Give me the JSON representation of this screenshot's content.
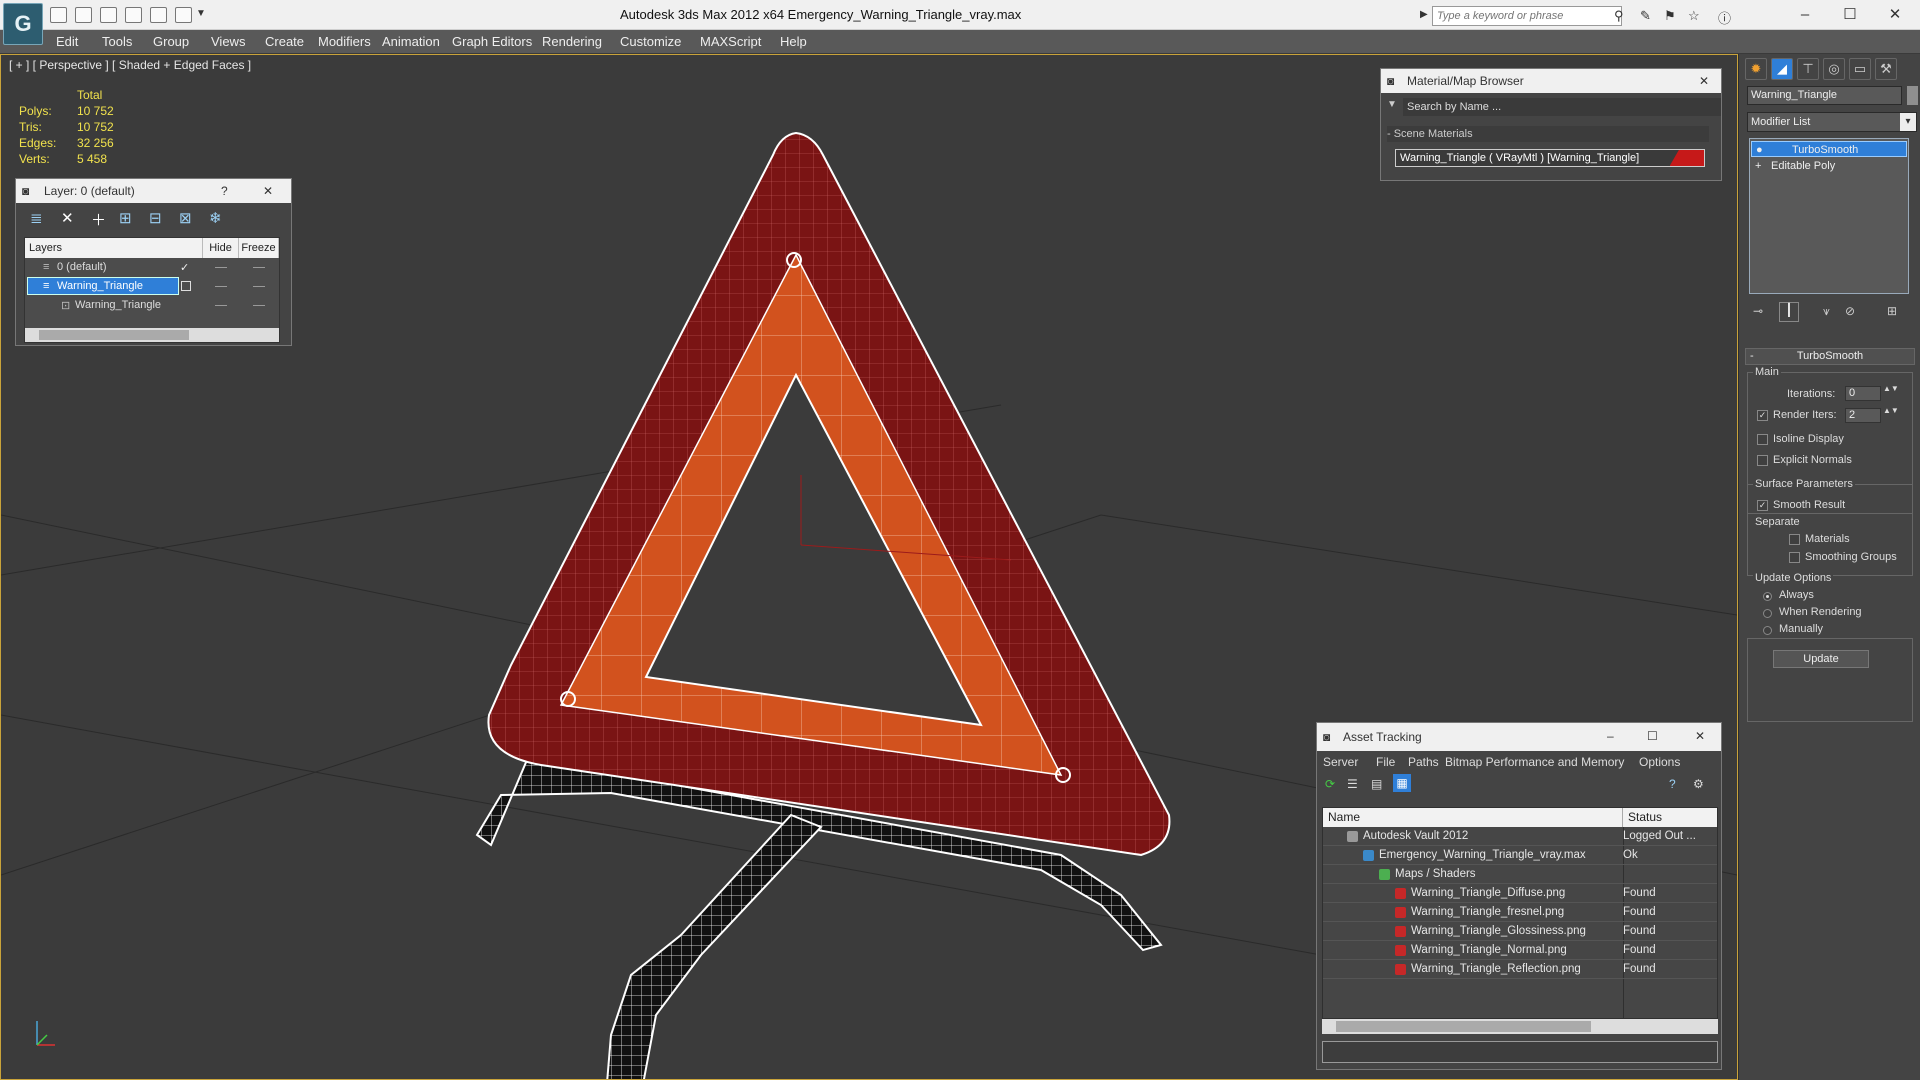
{
  "window": {
    "title": "Autodesk 3ds Max  2012 x64      Emergency_Warning_Triangle_vray.max",
    "search_placeholder": "Type a keyword or phrase",
    "logo": "G"
  },
  "menu": [
    "Edit",
    "Tools",
    "Group",
    "Views",
    "Create",
    "Modifiers",
    "Animation",
    "Graph Editors",
    "Rendering",
    "Customize",
    "MAXScript",
    "Help"
  ],
  "viewport": {
    "label": "[ + ] [ Perspective ] [ Shaded + Edged Faces ]",
    "stats": {
      "header": "Total",
      "polys_label": "Polys:",
      "polys": "10 752",
      "tris_label": "Tris:",
      "tris": "10 752",
      "edges_label": "Edges:",
      "edges": "32 256",
      "verts_label": "Verts:",
      "verts": "5 458"
    }
  },
  "layer_dialog": {
    "title": "Layer: 0 (default)",
    "help": "?",
    "columns": {
      "layers": "Layers",
      "hide": "Hide",
      "freeze": "Freeze"
    },
    "rows": [
      "0 (default)",
      "Warning_Triangle",
      "Warning_Triangle"
    ]
  },
  "material_browser": {
    "title": "Material/Map Browser",
    "search_placeholder": "Search by Name ...",
    "group": "- Scene Materials",
    "entry": "Warning_Triangle  ( VRayMtl )  [Warning_Triangle]"
  },
  "asset_tracking": {
    "title": "Asset Tracking",
    "menu": [
      "Server",
      "File",
      "Paths",
      "Bitmap Performance and Memory",
      "Options"
    ],
    "columns": {
      "name": "Name",
      "status": "Status"
    },
    "rows": [
      {
        "name": "Autodesk Vault 2012",
        "status": "Logged Out ..."
      },
      {
        "name": "Emergency_Warning_Triangle_vray.max",
        "status": "Ok"
      },
      {
        "name": "Maps / Shaders",
        "status": ""
      },
      {
        "name": "Warning_Triangle_Diffuse.png",
        "status": "Found"
      },
      {
        "name": "Warning_Triangle_fresnel.png",
        "status": "Found"
      },
      {
        "name": "Warning_Triangle_Glossiness.png",
        "status": "Found"
      },
      {
        "name": "Warning_Triangle_Normal.png",
        "status": "Found"
      },
      {
        "name": "Warning_Triangle_Reflection.png",
        "status": "Found"
      }
    ]
  },
  "command_panel": {
    "object_name": "Warning_Triangle",
    "modifier_list": "Modifier List",
    "stack": [
      "TurboSmooth",
      "Editable Poly"
    ],
    "rollout": {
      "title": "TurboSmooth",
      "main": "Main",
      "iterations_label": "Iterations:",
      "iterations": "0",
      "render_iters_label": "Render Iters:",
      "render_iters": "2",
      "isoline": "Isoline Display",
      "explicit_normals": "Explicit Normals",
      "surface_params": "Surface Parameters",
      "smooth_result": "Smooth Result",
      "separate": "Separate",
      "materials": "Materials",
      "smoothing_groups": "Smoothing Groups",
      "update_options": "Update Options",
      "always": "Always",
      "when_rendering": "When Rendering",
      "manually": "Manually",
      "update": "Update"
    }
  },
  "colors": {
    "stats": "#f1e24d",
    "reflector_red": "#7a1414",
    "reflector_orange": "#d2521e",
    "selection_blue": "#2f7fd8"
  }
}
